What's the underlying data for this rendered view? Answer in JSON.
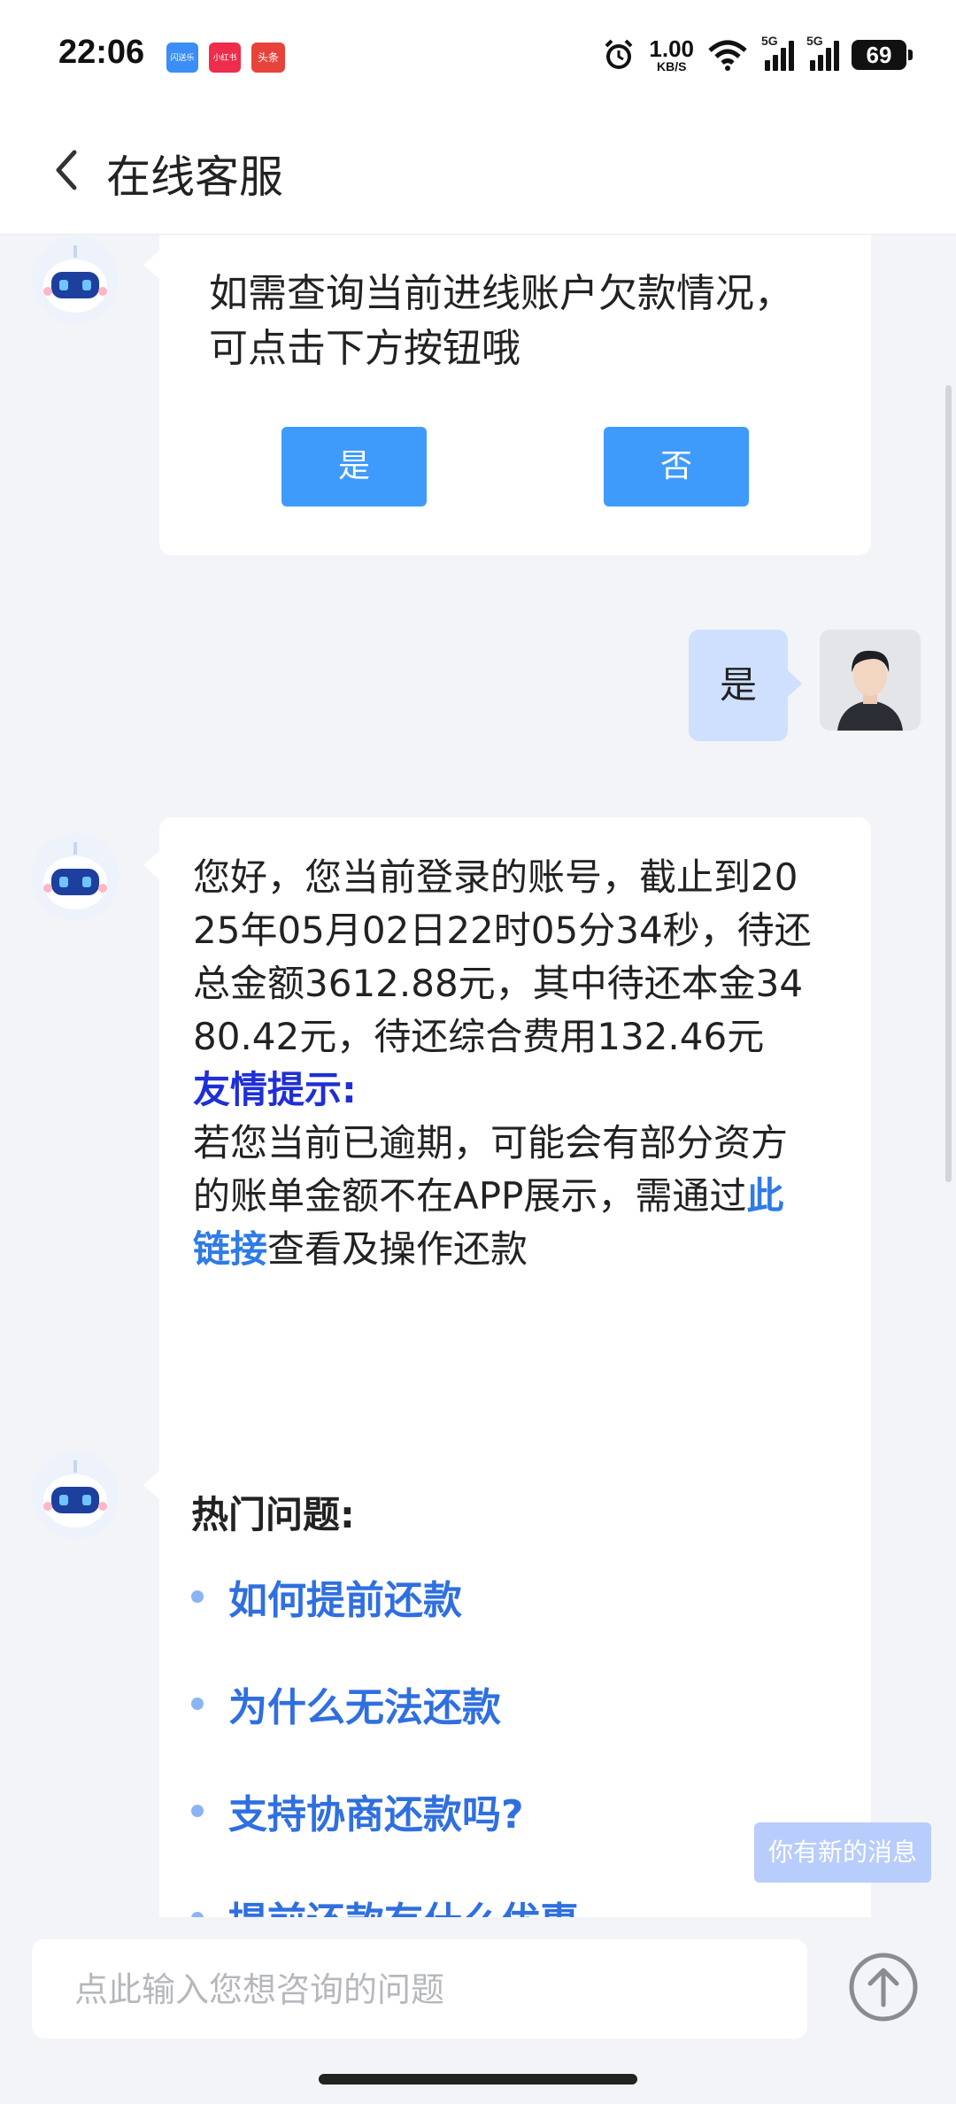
{
  "status_bar": {
    "time": "22:06",
    "apps": [
      {
        "label": "闪送乐",
        "color": "#3a8ef6"
      },
      {
        "label": "小红书",
        "color": "#ee2c4b"
      },
      {
        "label": "头条",
        "color": "#e8433a"
      }
    ],
    "net_speed_value": "1.00",
    "net_speed_unit": "KB/S",
    "signal_1": "5G",
    "signal_2": "5G",
    "battery": "69",
    "icons": [
      "alarm-icon",
      "wifi-icon",
      "signal-icon",
      "battery-icon"
    ]
  },
  "header": {
    "title": "在线客服",
    "back_icon": "chevron-left-icon"
  },
  "messages": {
    "bot_query": {
      "text": "如需查询当前进线账户欠款情况，可点击下方按钮哦",
      "yes_label": "是",
      "no_label": "否"
    },
    "user_reply": {
      "text": "是"
    },
    "bot_answer": {
      "text": "您好，您当前登录的账号，截止到2025年05月02日22时05分34秒，待还总金额3612.88元，其中待还本金3480.42元，待还综合费用132.46元",
      "tip_title": "友情提示:",
      "tip_text": "若您当前已逾期，可能会有部分资方的账单金额不在APP展示，需通过",
      "tip_link": "此链接",
      "tip_tail": "查看及操作还款"
    },
    "hot_questions": {
      "title": "热门问题:",
      "items": [
        {
          "label": "如何提前还款"
        },
        {
          "label": "为什么无法还款"
        },
        {
          "label": "支持协商还款吗?"
        },
        {
          "label": "提前还款有什么优惠"
        }
      ]
    }
  },
  "new_message_tip": "你有新的消息",
  "input": {
    "placeholder": "点此输入您想咨询的问题",
    "value": ""
  },
  "colors": {
    "button_blue": "#3f9bfb",
    "link_blue": "#2f7be5",
    "tip_blue": "#1f2fd6",
    "user_bubble": "#cfe0ff",
    "background": "#f3f4f8"
  }
}
